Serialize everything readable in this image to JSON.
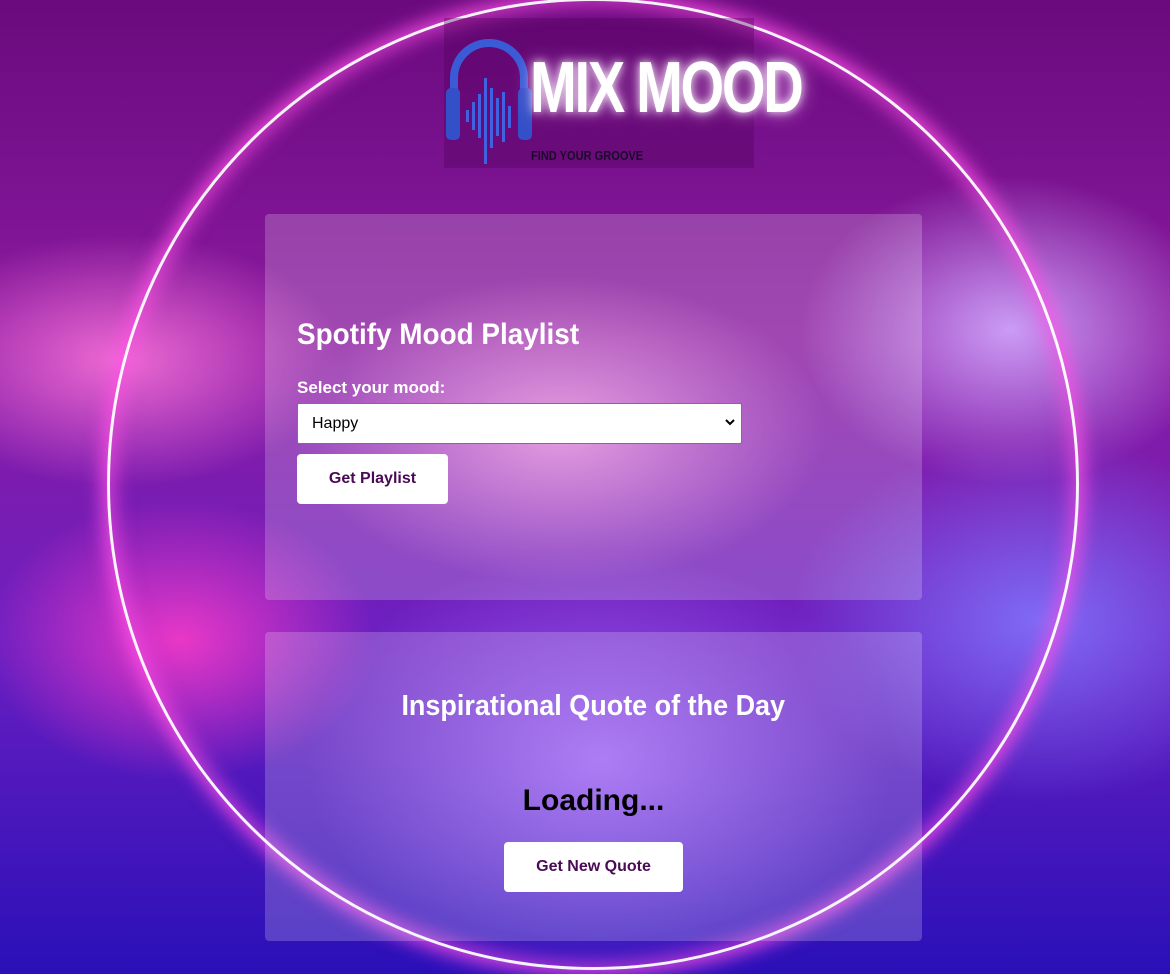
{
  "logo": {
    "title": "MIX MOOD",
    "tagline": "FIND YOUR GROOVE",
    "colors": {
      "headphones": "#3b5bd6",
      "glow": "#ffffff"
    }
  },
  "playlist": {
    "title": "Spotify Mood Playlist",
    "label": "Select your mood:",
    "selected_mood": "Happy",
    "button_label": "Get Playlist"
  },
  "quote": {
    "title": "Inspirational Quote of the Day",
    "text": "Loading...",
    "button_label": "Get New Quote"
  },
  "colors": {
    "button_text": "#4a0a55",
    "ring_glow": "#ff50e6"
  }
}
